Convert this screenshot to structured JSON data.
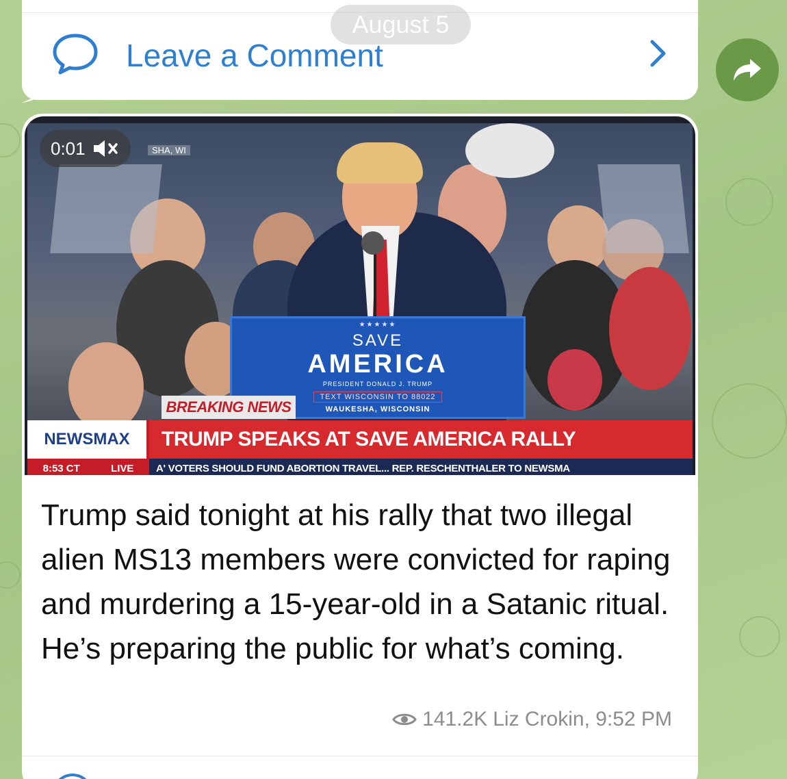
{
  "date_pill": "August 5",
  "comment_bar": {
    "label": "Leave a Comment"
  },
  "video": {
    "timer": "0:01",
    "partial_overlay_text": "SHA, WI",
    "podium": {
      "stars": "★★★★★",
      "save": "SAVE",
      "america": "AMERICA",
      "president": "PRESIDENT DONALD J. TRUMP",
      "text_line": "TEXT WISCONSIN TO 88022",
      "location": "WAUKESHA, WISCONSIN"
    },
    "breaking": "BREAKING NEWS",
    "network": "NEWSMAX",
    "headline": "TRUMP SPEAKS AT SAVE AMERICA RALLY",
    "time": "8:53 CT",
    "live": "LIVE",
    "ticker": "A' VOTERS SHOULD FUND ABORTION TRAVEL...     REP. RESCHENTHALER TO NEWSMA"
  },
  "caption": "Trump said tonight at his rally that two illegal alien MS13 members were convicted for raping and murdering a 15-year-old in a Satanic ritual. He’s preparing the public for what’s coming.",
  "meta": {
    "views": "141.2K",
    "author_time": "Liz Crokin, 9:52 PM"
  },
  "colors": {
    "link": "#2f7fd0",
    "share_button": "#6a9a48",
    "wallpaper": "#a9c98a"
  },
  "icons": [
    "comment-icon",
    "chevron-right-icon",
    "share-icon",
    "mute-icon",
    "eye-icon"
  ]
}
